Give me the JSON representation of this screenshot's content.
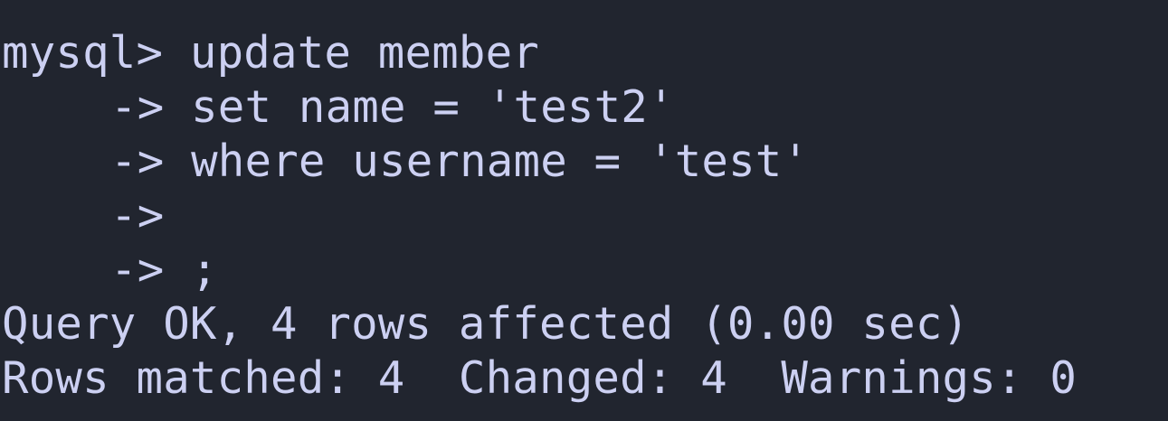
{
  "terminal": {
    "lines": [
      "mysql> update member",
      "-> set name = 'test2'",
      "-> where username = 'test'",
      "->",
      "-> ;",
      "Query OK, 4 rows affected (0.00 sec)",
      "Rows matched: 4  Changed: 4  Warnings: 0"
    ]
  },
  "colors": {
    "background": "#21252f",
    "text": "#ccd0f2"
  }
}
